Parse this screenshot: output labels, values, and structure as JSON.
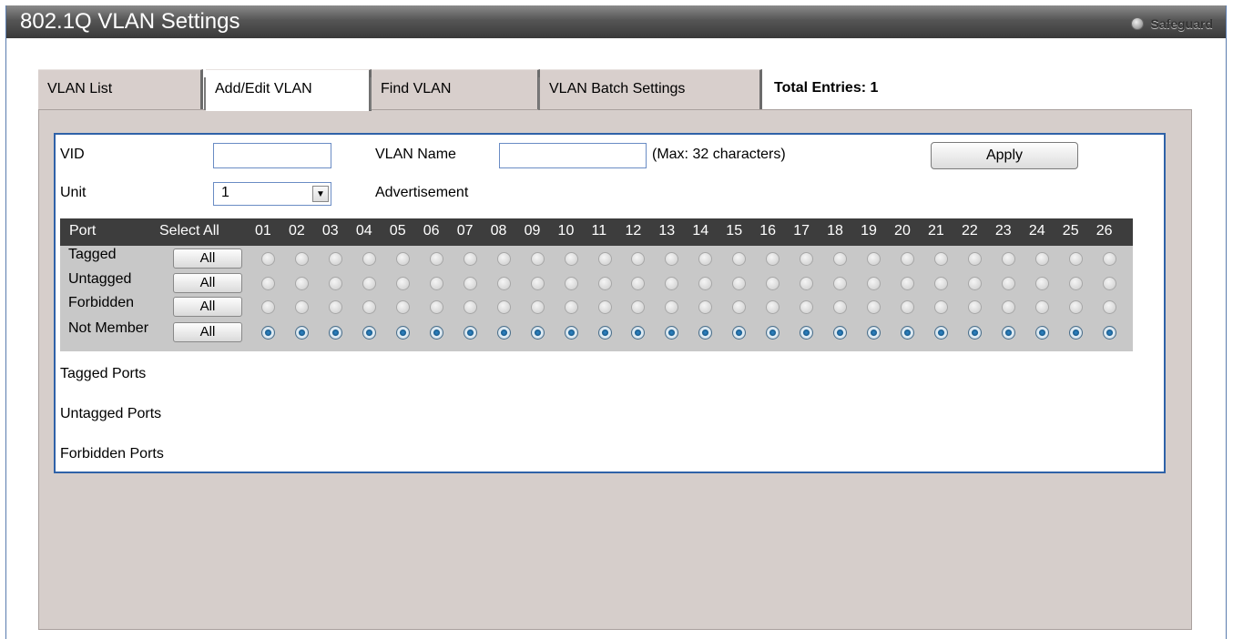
{
  "title": "802.1Q VLAN Settings",
  "safeguard": {
    "label": "Safeguard",
    "icon": "status-dot-icon"
  },
  "tabs": [
    {
      "label": "VLAN List"
    },
    {
      "label": "Add/Edit VLAN"
    },
    {
      "label": "Find VLAN"
    },
    {
      "label": "VLAN Batch Settings"
    }
  ],
  "active_tab": "Add/Edit VLAN",
  "total_entries": "Total Entries: 1",
  "form": {
    "vid_label": "VID",
    "vid_value": "",
    "vlan_name_label": "VLAN Name",
    "vlan_name_value": "",
    "max_hint": "(Max: 32 characters)",
    "apply": "Apply",
    "unit_label": "Unit",
    "unit_value": "1",
    "advertisement_label": "Advertisement"
  },
  "grid": {
    "port_header": "Port",
    "select_all_header": "Select All",
    "all_label": "All",
    "ports": [
      "01",
      "02",
      "03",
      "04",
      "05",
      "06",
      "07",
      "08",
      "09",
      "10",
      "11",
      "12",
      "13",
      "14",
      "15",
      "16",
      "17",
      "18",
      "19",
      "20",
      "21",
      "22",
      "23",
      "24",
      "25",
      "26"
    ],
    "rows": [
      {
        "label": "Tagged",
        "selected": false
      },
      {
        "label": "Untagged",
        "selected": false
      },
      {
        "label": "Forbidden",
        "selected": false
      },
      {
        "label": "Not Member",
        "selected": true
      }
    ]
  },
  "summary": {
    "tagged_ports": "Tagged Ports",
    "untagged_ports": "Untagged Ports",
    "forbidden_ports": "Forbidden Ports"
  },
  "colors": {
    "titlebar": "#4a4a4a",
    "panel_border": "#2f62a8",
    "content_bg": "#d6cecb",
    "radio_selected": "#1b5e90"
  }
}
